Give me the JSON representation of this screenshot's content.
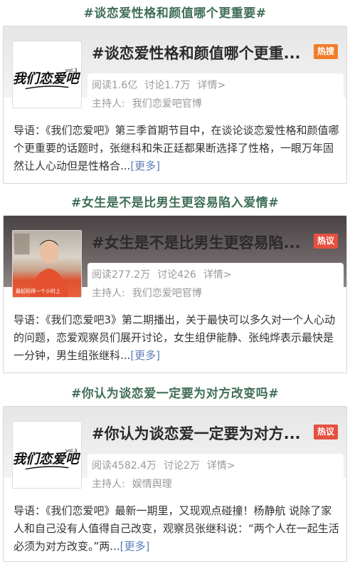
{
  "topics": [
    {
      "section_title": "#谈恋爱性格和颜值哪个更重要#",
      "card_title": "#谈恋爱性格和颜值哪个更重...",
      "badge": "热搜",
      "badge_color": "#f27d2c",
      "reads": "阅读1.6亿",
      "discussions": "讨论1.7万",
      "detail_link": "详情>",
      "host_label": "主持人:",
      "host_name": "我们恋爱吧官博",
      "intro": "导语：《我们恋爱吧》第三季首期节目中，在谈论谈恋爱性格和颜值哪个更重要的话题时，张继科和朱正廷都果断选择了性格，一眼万年固然让人心动但是性格合",
      "ellipsis": "...",
      "more_link": "[更多]",
      "thumb": "show-logo",
      "logo_text": "我们恋爱吧",
      "logo_sub": "vol.3"
    },
    {
      "section_title": "#女生是不是比男生更容易陷入爱情#",
      "card_title": "#女生是不是比男生更容易陷...",
      "badge": "热议",
      "badge_color": "#e5503f",
      "reads": "阅读277.2万",
      "discussions": "讨论426",
      "detail_link": "详情>",
      "host_label": "主持人:",
      "host_name": "我们恋爱吧官博",
      "intro": "导语：《我们恋爱吧3》第二期播出，关于最快可以多久对一个人心动的问题，恋爱观察员们展开讨论，女生组伊能静、张纯烨表示最快是一分钟，男生组张继科",
      "ellipsis": "...",
      "more_link": "[更多]",
      "thumb": "guest-photo",
      "photo_caption": "最起码得一个小时上"
    },
    {
      "section_title": "#你认为谈恋爱一定要为对方改变吗#",
      "card_title": "#你认为谈恋爱一定要为对方...",
      "badge": "热议",
      "badge_color": "#e5503f",
      "reads": "阅读4582.4万",
      "discussions": "讨论2万",
      "detail_link": "详情>",
      "host_label": "主持人:",
      "host_name": "娱情舆理",
      "intro": "导语：《我们恋爱吧》最新一期里，又现观点碰撞！杨静航 说除了家人和自己没有人值得自己改变，观察员张继科说：“两个人在一起生活必须为对方改变。”两",
      "ellipsis": "...",
      "more_link": "[更多]",
      "thumb": "show-logo",
      "logo_text": "我们恋爱吧",
      "logo_sub": "vol.3"
    }
  ],
  "colors": {
    "section_title": "#3f6e57",
    "link": "#5b7db8",
    "muted": "#999999"
  }
}
